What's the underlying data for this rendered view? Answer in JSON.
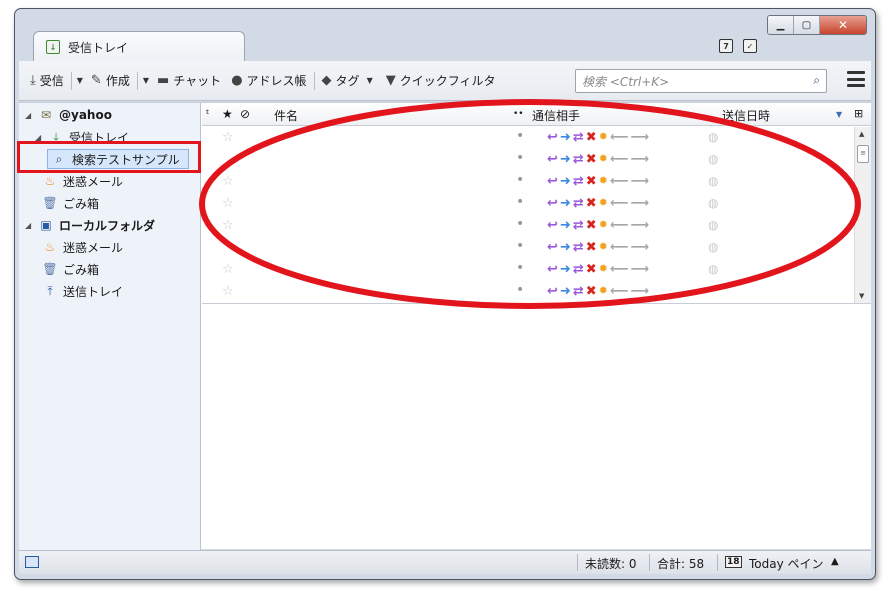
{
  "window": {
    "tab_title": "受信トレイ",
    "controls": {
      "minimize": "▁",
      "maximize": "▢",
      "close": "✕"
    }
  },
  "toolbar": {
    "get_mail": "受信",
    "write": "作成",
    "chat": "チャット",
    "address_book": "アドレス帳",
    "tag": "タグ",
    "quick_filter": "クイックフィルタ",
    "search_placeholder": "検索 <Ctrl+K>"
  },
  "folders": {
    "account1": "@yahoo",
    "inbox": "受信トレイ",
    "saved_search": "検索テストサンプル",
    "junk1": "迷惑メール",
    "trash1": "ごみ箱",
    "local_folders": "ローカルフォルダ",
    "junk2": "迷惑メール",
    "trash2": "ごみ箱",
    "sent": "送信トレイ"
  },
  "columns": {
    "thread": "ᵗ",
    "star": "★",
    "attachment": "⊘",
    "subject": "件名",
    "read": "••",
    "correspondents": "通信相手",
    "date": "送信日時",
    "picker": "⊞"
  },
  "rows": [
    {
      "star": "☆",
      "junk": "◍"
    },
    {
      "star": "",
      "junk": "◍"
    },
    {
      "star": "☆",
      "junk": "◍"
    },
    {
      "star": "☆",
      "junk": "◍"
    },
    {
      "star": "☆",
      "junk": "◍"
    },
    {
      "star": "",
      "junk": "◍"
    },
    {
      "star": "☆",
      "junk": "◍"
    },
    {
      "star": "☆",
      "junk": ""
    }
  ],
  "statusbar": {
    "unread": "未読数: 0",
    "total": "合計: 58",
    "today_pane": "Today ペイン",
    "today_icon_num": "18"
  },
  "colors": {
    "highlight": "#e2141c",
    "selected_folder_bg": "#d6e6fb"
  }
}
